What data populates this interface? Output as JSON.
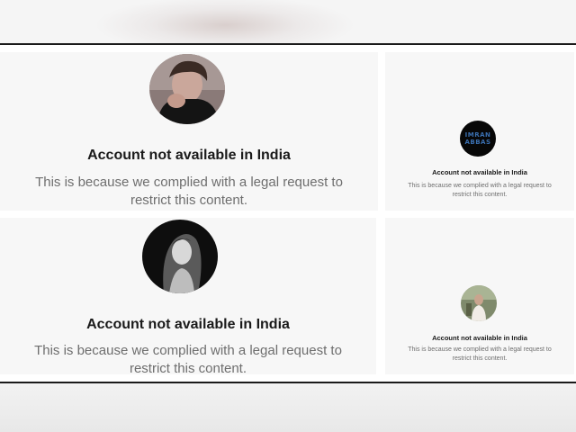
{
  "cards": [
    {
      "title": "Account not available in India",
      "line1": "This is because we complied with a legal request to",
      "line2": "restrict this content."
    },
    {
      "title": "Account not available in India",
      "line1": "This is because we complied with a legal request to",
      "line2": "restrict this content."
    },
    {
      "title": "Account not available in India",
      "line1": "This is because we complied with a legal request to",
      "line2": "restrict this content.",
      "logo_line1": "IMRAN",
      "logo_line2": "ABBAS"
    },
    {
      "title": "Account not available in India",
      "line1": "This is because we complied with a legal request to",
      "line2": "restrict this content."
    }
  ]
}
